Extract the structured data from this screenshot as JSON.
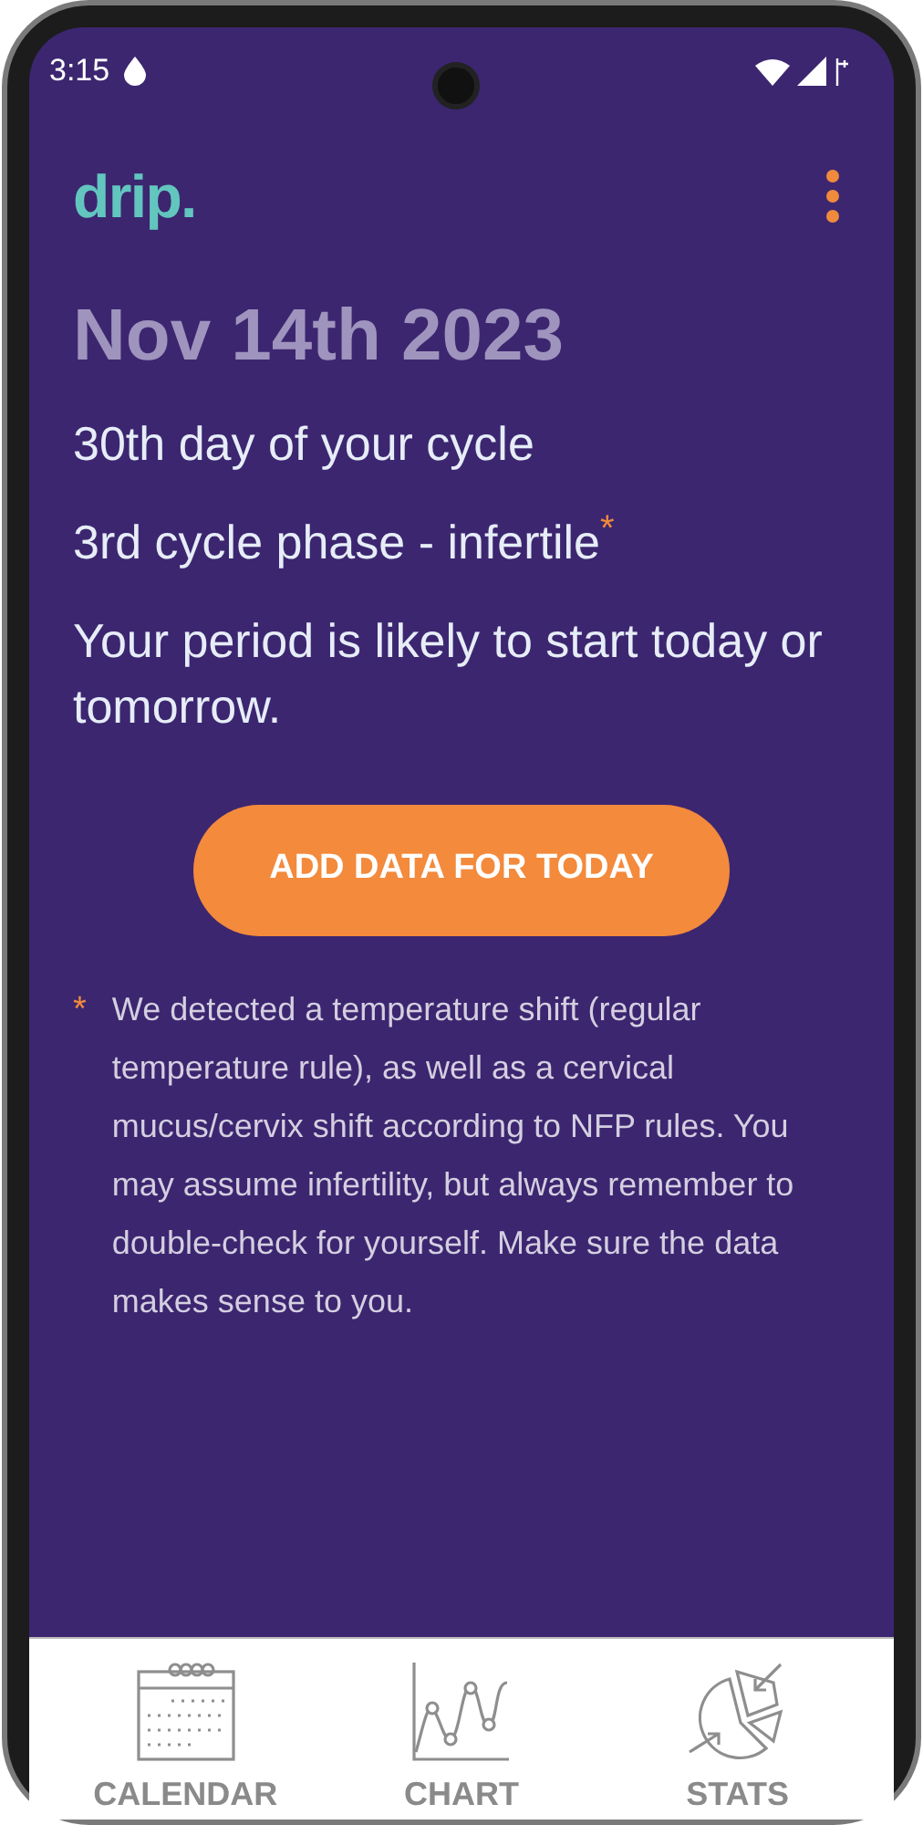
{
  "status_bar": {
    "time": "3:15"
  },
  "app_bar": {
    "logo": "drip."
  },
  "date": "Nov 14th 2023",
  "info_lines": [
    {
      "text": "30th day of your cycle"
    },
    {
      "text": "3rd cycle phase - infertile",
      "note_mark": "*"
    },
    {
      "text": "Your period is likely to start today or tomorrow."
    }
  ],
  "primary_button": "ADD DATA FOR TODAY",
  "footnote": {
    "mark": "*",
    "text": "We detected a temperature shift (regular temperature rule), as well as a cervical mucus/cervix shift according to NFP rules. You may assume infertility, but always remember to double-check for yourself. Make sure the data makes sense to you."
  },
  "bottom_nav": [
    {
      "kind": "calendar",
      "label": "CALENDAR"
    },
    {
      "kind": "chart",
      "label": "CHART"
    },
    {
      "kind": "stats",
      "label": "STATS"
    }
  ]
}
